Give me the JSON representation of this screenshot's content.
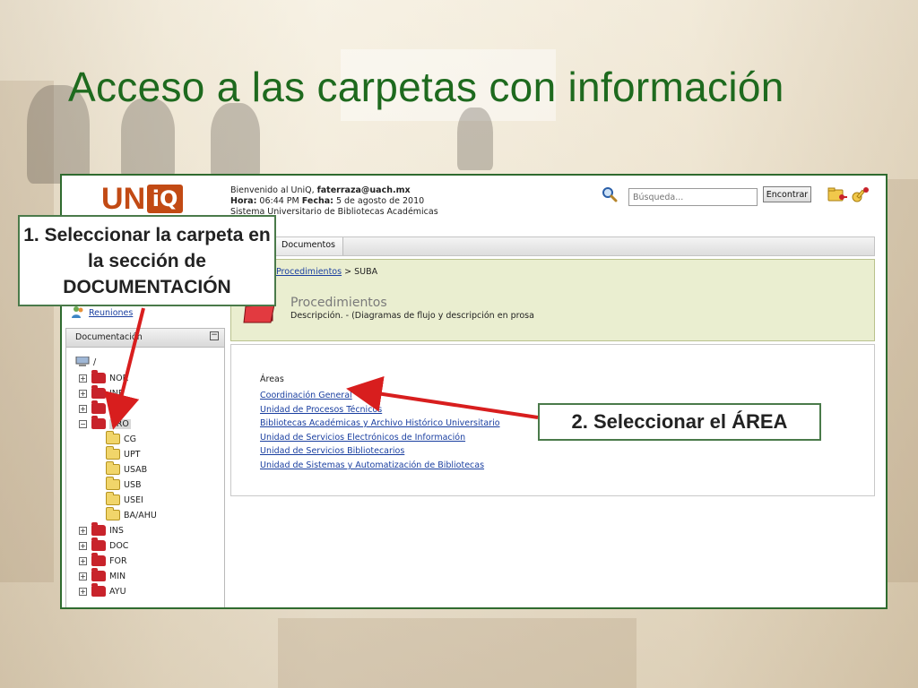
{
  "slide": {
    "title": "Acceso a las carpetas con información"
  },
  "app": {
    "logo_text_u": "U",
    "logo_text_n": "N",
    "logo_text_iq": "iQ",
    "welcome_prefix": "Bienvenido al UniQ,",
    "welcome_user": "faterraza@uach.mx",
    "hora_label": "Hora:",
    "hora_value": "06:44 PM",
    "fecha_label": "Fecha:",
    "fecha_value": "5 de agosto de 2010",
    "system_name": "Sistema Universitario de Bibliotecas Académicas",
    "search_placeholder": "Búsqueda...",
    "search_button": "Encontrar",
    "tab_label": "Documentos"
  },
  "breadcrumb": {
    "link": "Procedimientos",
    "separator": ">",
    "current": "SUBA"
  },
  "procedure": {
    "title": "Procedimientos",
    "description": "Descripción. - (Diagramas de flujo y descripción en prosa"
  },
  "areas": {
    "heading": "Áreas",
    "items": [
      "Coordinación General",
      "Unidad de Procesos Técnicos",
      "Bibliotecas Académicas y Archivo Histórico Universitario",
      "Unidad de Servicios Electrónicos de Información",
      "Unidad de Servicios Bibliotecarios",
      "Unidad de Sistemas y Automatización de Bibliotecas"
    ]
  },
  "sidebar": {
    "reuniones": "Reuniones",
    "documentacion_header": "Documentación",
    "root": "/",
    "folders_top": [
      "NOR",
      "INF",
      "ARN",
      "PRO"
    ],
    "pro_children": [
      "CG",
      "UPT",
      "USAB",
      "USB",
      "USEI",
      "BA/AHU"
    ],
    "folders_bottom": [
      "INS",
      "DOC",
      "FOR",
      "MIN",
      "AYU"
    ]
  },
  "callouts": {
    "step1": "1. Seleccionar la carpeta en la sección de DOCUMENTACIÓN",
    "step2": "2. Seleccionar el ÁREA"
  },
  "colors": {
    "title_green": "#1e6a1e",
    "logo_orange": "#c24a14",
    "folder_red": "#c8232b",
    "arrow_red": "#d81e1e",
    "link_blue": "#1a3fa0"
  },
  "icons": [
    "search-icon",
    "folder-key-icon",
    "key-icon",
    "user-group-icon",
    "computer-icon",
    "red-folder-icon",
    "yellow-folder-icon"
  ]
}
